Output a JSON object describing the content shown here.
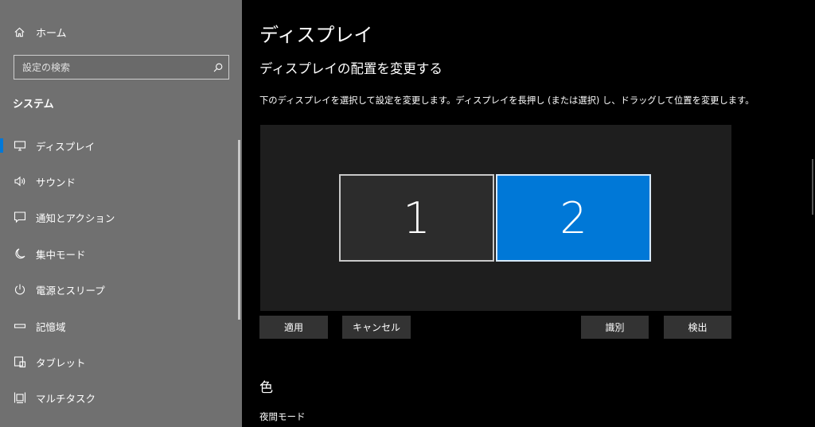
{
  "sidebar": {
    "home_label": "ホーム",
    "search_placeholder": "設定の検索",
    "section_title": "システム",
    "items": [
      {
        "label": "ディスプレイ",
        "icon": "monitor-icon",
        "selected": true
      },
      {
        "label": "サウンド",
        "icon": "speaker-icon"
      },
      {
        "label": "通知とアクション",
        "icon": "notification-icon"
      },
      {
        "label": "集中モード",
        "icon": "moon-icon"
      },
      {
        "label": "電源とスリープ",
        "icon": "power-icon"
      },
      {
        "label": "記憶域",
        "icon": "storage-icon"
      },
      {
        "label": "タブレット",
        "icon": "tablet-icon"
      },
      {
        "label": "マルチタスク",
        "icon": "multitask-icon"
      }
    ]
  },
  "main": {
    "title": "ディスプレイ",
    "subheading": "ディスプレイの配置を変更する",
    "description": "下のディスプレイを選択して設定を変更します。ディスプレイを長押し (または選択) し、ドラッグして位置を変更します。",
    "monitors": [
      {
        "number": "1",
        "selected": false
      },
      {
        "number": "2",
        "selected": true
      }
    ],
    "buttons": {
      "apply": "適用",
      "cancel": "キャンセル",
      "identify": "識別",
      "detect": "検出"
    },
    "color_heading": "色",
    "night_mode_label": "夜間モード"
  },
  "colors": {
    "accent": "#0078d7",
    "sidebar_bg": "#707070",
    "main_bg": "#000000",
    "button_bg": "#333333"
  }
}
